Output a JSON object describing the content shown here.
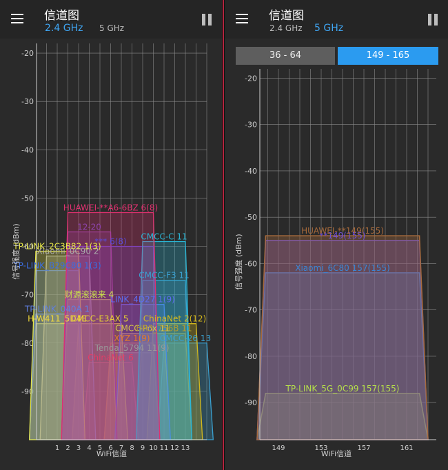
{
  "left": {
    "title": "信道图",
    "band_24": "2.4 GHz",
    "band_5": "5 GHz",
    "active_band": "2.4 GHz",
    "chart_data": {
      "type": "area",
      "ylabel": "信号强度 (dBm)",
      "xlabel": "WiFi信道",
      "ylim": [
        -100,
        -18
      ],
      "yticks": [
        -20,
        -30,
        -40,
        -50,
        -60,
        -70,
        -80,
        -90
      ],
      "xticks": [
        "1",
        "2",
        "3",
        "4",
        "5",
        "6",
        "7",
        "8",
        "9",
        "10",
        "11",
        "12",
        "13"
      ],
      "grid": true,
      "series": [
        {
          "label": "HUAWEI-**A6-6BZ 6(8)",
          "channel": 6,
          "width": 8,
          "dbm": -53,
          "color": "#e0306f"
        },
        {
          "label": "CMCC-C 11",
          "channel": 11,
          "width": 4,
          "dbm": -59,
          "color": "#29b6d6"
        },
        {
          "label": "12-20",
          "channel": 4,
          "width": 4,
          "dbm": -57,
          "color": "#8e44ad"
        },
        {
          "label": "TP-LINK_2C3B82 1(3)",
          "channel": 1,
          "width": 4,
          "dbm": -61,
          "color": "#e6e645"
        },
        {
          "label": "Xiaomi_0C90 2",
          "channel": 2,
          "width": 4,
          "dbm": -62,
          "color": "#aaaaaa"
        },
        {
          "label": "*** 6(8)",
          "channel": 6,
          "width": 8,
          "dbm": -60,
          "color": "#5b4bd8"
        },
        {
          "label": "TP-LINK_B29C80 1(3)",
          "channel": 1,
          "width": 4,
          "dbm": -65,
          "color": "#3b6de0"
        },
        {
          "label": "CMCC-F3 11",
          "channel": 11,
          "width": 4,
          "dbm": -67,
          "color": "#3ba0d0"
        },
        {
          "label": "财源滚滚来 4",
          "channel": 4,
          "width": 4,
          "dbm": -71,
          "color": "#c8e04a"
        },
        {
          "label": "LINK_4D27 1(9)",
          "channel": 9,
          "width": 4,
          "dbm": -72,
          "color": "#5d6df0"
        },
        {
          "label": "TP-LINK_040A 1",
          "channel": 1,
          "width": 4,
          "dbm": -74,
          "color": "#5f7fe0"
        },
        {
          "label": "H-W411_5D4E",
          "channel": 1,
          "width": 4,
          "dbm": -76,
          "color": "#f0d93b"
        },
        {
          "label": "CMCC-E3AX 5",
          "channel": 5,
          "width": 4,
          "dbm": -76,
          "color": "#e6cf32"
        },
        {
          "label": "ChinaNet 2(12)",
          "channel": 12,
          "width": 4,
          "dbm": -76,
          "color": "#d4b91c"
        },
        {
          "label": "CMCC-Pox 11",
          "channel": 9,
          "width": 4,
          "dbm": -78,
          "color": "#d6c44a"
        },
        {
          "label": "HR3_756B 11",
          "channel": 11,
          "width": 4,
          "dbm": -78,
          "color": "#b09a30"
        },
        {
          "label": "CMCC-26 13",
          "channel": 13,
          "width": 4,
          "dbm": -80,
          "color": "#3aa0d0"
        },
        {
          "label": "XYZ 1(9)",
          "channel": 8,
          "width": 4,
          "dbm": -80,
          "color": "#e07a2c"
        },
        {
          "label": "Tenda_5794 11(9)",
          "channel": 8,
          "width": 4,
          "dbm": -82,
          "color": "#999999"
        },
        {
          "label": "ChinaNet 6",
          "channel": 6,
          "width": 4,
          "dbm": -84,
          "color": "#e33d66"
        }
      ]
    }
  },
  "right": {
    "title": "信道图",
    "band_24": "2.4 GHz",
    "band_5": "5 GHz",
    "active_band": "5 GHz",
    "segments": [
      {
        "label": "36 - 64",
        "active": false
      },
      {
        "label": "149 - 165",
        "active": true
      }
    ],
    "chart_data": {
      "type": "area",
      "ylabel": "信号强度 (dBm)",
      "xlabel": "WiFi信道",
      "ylim": [
        -98,
        -18
      ],
      "yticks": [
        -20,
        -30,
        -40,
        -50,
        -60,
        -70,
        -80,
        -90
      ],
      "xticks": [
        "149",
        "153",
        "157",
        "161"
      ],
      "grid": true,
      "series": [
        {
          "label": "HUAWEI-**149(155)",
          "channel_from": 149,
          "channel_to": 161,
          "dbm": -54,
          "color": "#a66a3c"
        },
        {
          "label": "**149(155)",
          "channel_from": 149,
          "channel_to": 161,
          "dbm": -55,
          "color": "#6f4fd8"
        },
        {
          "label": "Xiaomi_6C80 157(155)",
          "channel_from": 149,
          "channel_to": 161,
          "dbm": -62,
          "color": "#3a86d6"
        },
        {
          "label": "TP-LINK_5G_0C99 157(155)",
          "channel_from": 149,
          "channel_to": 161,
          "dbm": -88,
          "color": "#b6e04a"
        }
      ]
    }
  }
}
